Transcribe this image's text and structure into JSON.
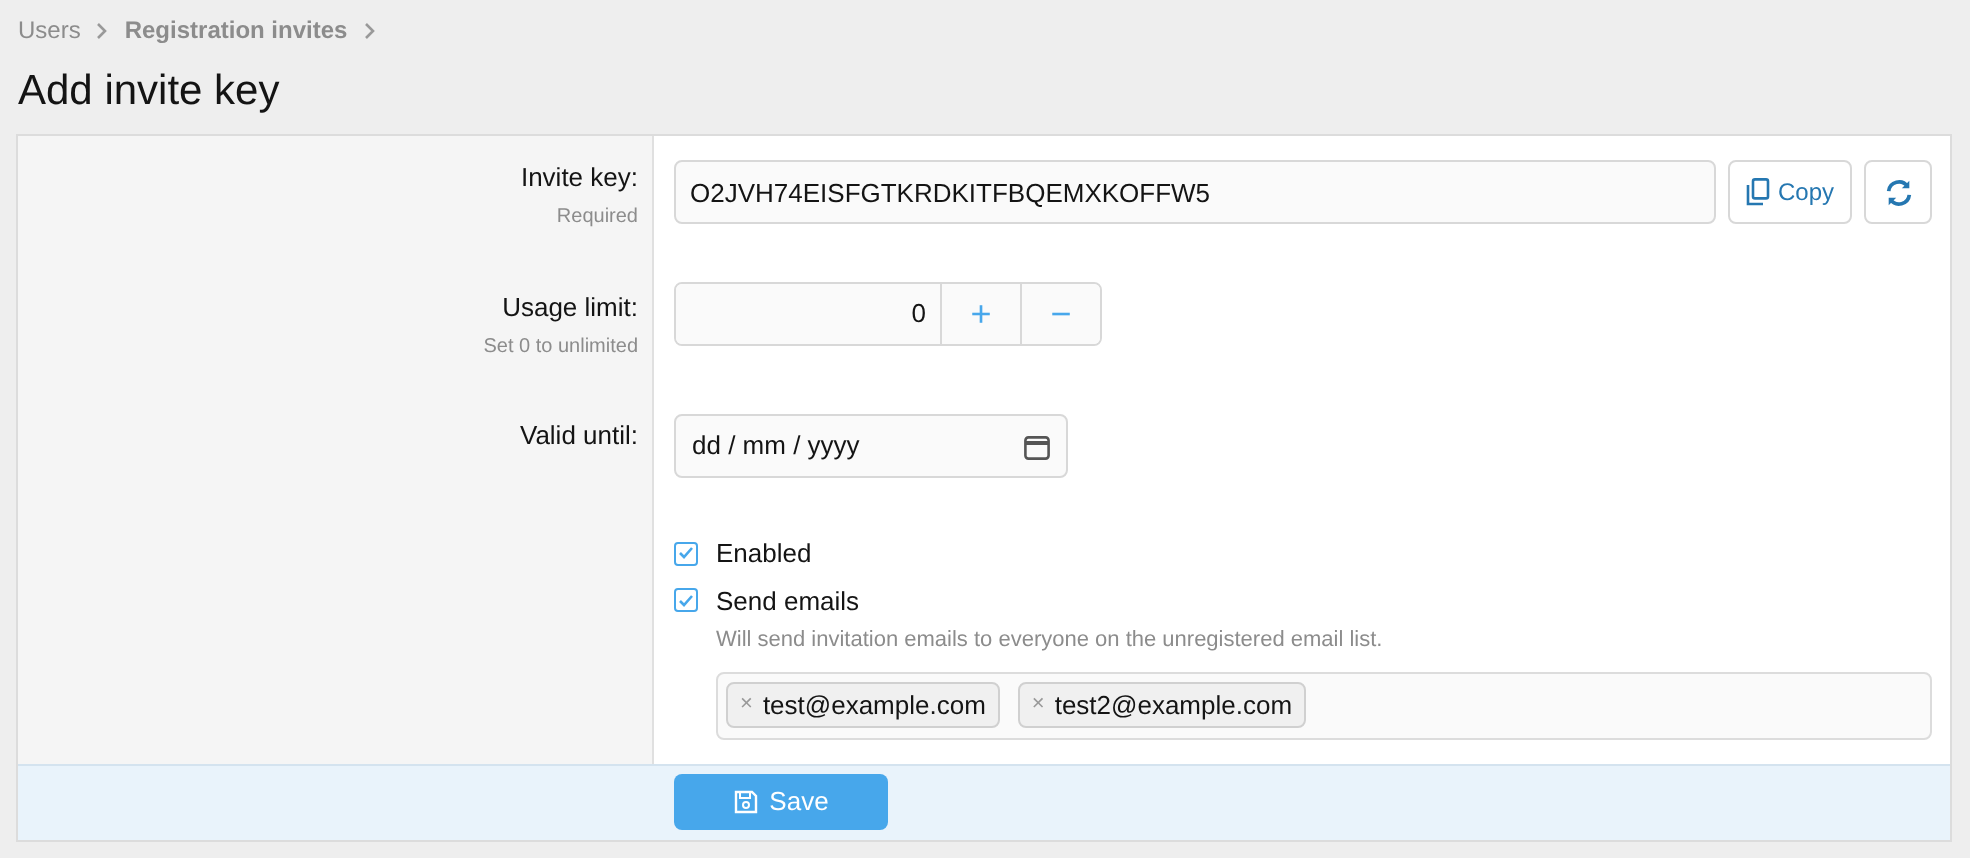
{
  "breadcrumbs": [
    {
      "label": "Users"
    },
    {
      "label": "Registration invites"
    }
  ],
  "title": "Add invite key",
  "invite_key": {
    "label": "Invite key:",
    "hint": "Required",
    "value": "O2JVH74EISFGTKRDKITFBQEMXKOFFW5",
    "copy_button": "Copy"
  },
  "usage_limit": {
    "label": "Usage limit:",
    "hint": "Set 0 to unlimited",
    "value": "0",
    "plus": "+",
    "minus": "−"
  },
  "valid_until": {
    "label": "Valid until:",
    "placeholder": "dd / mm / yyyy"
  },
  "options": [
    {
      "label": "Enabled",
      "checked": true
    },
    {
      "label": "Send emails",
      "checked": true,
      "description": "Will send invitation emails to everyone on the unregistered email list."
    }
  ],
  "emails": [
    {
      "label": "test@example.com",
      "remove": "×"
    },
    {
      "label": "test2@example.com",
      "remove": "×"
    }
  ],
  "save_button": "Save"
}
